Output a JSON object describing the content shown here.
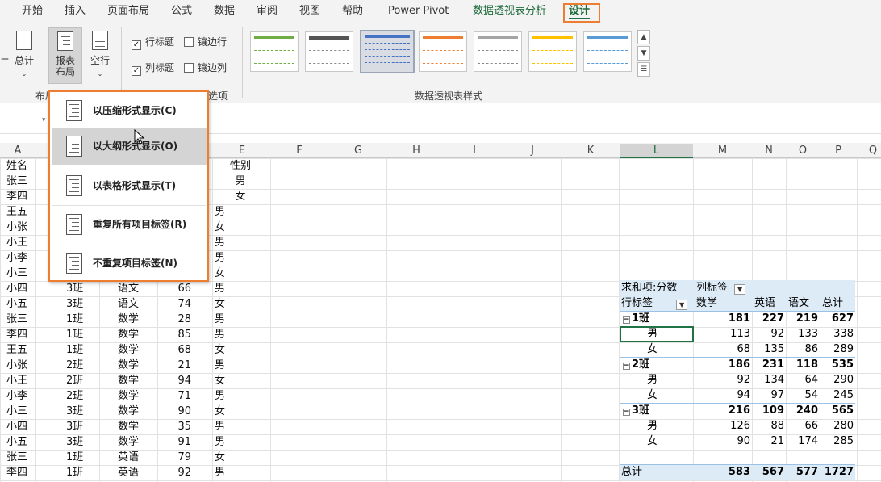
{
  "tabs": [
    "开始",
    "插入",
    "页面布局",
    "公式",
    "数据",
    "审阅",
    "视图",
    "帮助",
    "Power Pivot",
    "数据透视表分析",
    "设计"
  ],
  "ribbon": {
    "layout_buttons": {
      "subtotal": "总计",
      "report_layout": "报表布局",
      "blank_rows": "空行"
    },
    "left_edge_label": "二",
    "options": {
      "row_headers": "行标题",
      "col_headers": "列标题",
      "banded_rows": "镶边行",
      "banded_cols": "镶边列"
    },
    "groups": {
      "layout": "布局",
      "style_options": "选项",
      "styles": "数据透视表样式"
    }
  },
  "menu": {
    "items": [
      "以压缩形式显示(C)",
      "以大纲形式显示(O)",
      "以表格形式显示(T)",
      "重复所有项目标签(R)",
      "不重复项目标签(N)"
    ],
    "hover_index": 1
  },
  "column_headers": [
    "A",
    "B",
    "C",
    "D",
    "E",
    "F",
    "G",
    "H",
    "I",
    "J",
    "K",
    "L",
    "M",
    "N",
    "O",
    "P",
    "Q"
  ],
  "sheet": {
    "header": [
      "姓名",
      "",
      "",
      "",
      "性别"
    ],
    "rows": [
      [
        "张三",
        "",
        "",
        "",
        "男"
      ],
      [
        "李四",
        "",
        "",
        "",
        "女"
      ],
      [
        "王五",
        "",
        "",
        "",
        "男"
      ],
      [
        "小张",
        "",
        "",
        "",
        "女"
      ],
      [
        "小王",
        "",
        "",
        "",
        "男"
      ],
      [
        "小李",
        "",
        "",
        "",
        "男"
      ],
      [
        "小三",
        "",
        "",
        "",
        "女"
      ],
      [
        "小四",
        "3班",
        "语文",
        "66",
        "男"
      ],
      [
        "小五",
        "3班",
        "语文",
        "74",
        "女"
      ],
      [
        "张三",
        "1班",
        "数学",
        "28",
        "男"
      ],
      [
        "李四",
        "1班",
        "数学",
        "85",
        "男"
      ],
      [
        "王五",
        "1班",
        "数学",
        "68",
        "女"
      ],
      [
        "小张",
        "2班",
        "数学",
        "21",
        "男"
      ],
      [
        "小王",
        "2班",
        "数学",
        "94",
        "女"
      ],
      [
        "小李",
        "2班",
        "数学",
        "71",
        "男"
      ],
      [
        "小三",
        "3班",
        "数学",
        "90",
        "女"
      ],
      [
        "小四",
        "3班",
        "数学",
        "35",
        "男"
      ],
      [
        "小五",
        "3班",
        "数学",
        "91",
        "男"
      ],
      [
        "张三",
        "1班",
        "英语",
        "79",
        "女"
      ],
      [
        "李四",
        "1班",
        "英语",
        "92",
        "男"
      ]
    ]
  },
  "pivot": {
    "corner": "求和项:分数",
    "col_label": "列标签",
    "row_label": "行标签",
    "columns": [
      "数学",
      "英语",
      "语文",
      "总计"
    ],
    "rows": [
      {
        "label": "1班",
        "level": 0,
        "values": [
          "181",
          "227",
          "219",
          "627"
        ]
      },
      {
        "label": "男",
        "level": 1,
        "values": [
          "113",
          "92",
          "133",
          "338"
        ]
      },
      {
        "label": "女",
        "level": 1,
        "values": [
          "68",
          "135",
          "86",
          "289"
        ]
      },
      {
        "label": "2班",
        "level": 0,
        "values": [
          "186",
          "231",
          "118",
          "535"
        ]
      },
      {
        "label": "男",
        "level": 1,
        "values": [
          "92",
          "134",
          "64",
          "290"
        ]
      },
      {
        "label": "女",
        "level": 1,
        "values": [
          "94",
          "97",
          "54",
          "245"
        ]
      },
      {
        "label": "3班",
        "level": 0,
        "values": [
          "216",
          "109",
          "240",
          "565"
        ]
      },
      {
        "label": "男",
        "level": 1,
        "values": [
          "126",
          "88",
          "66",
          "280"
        ]
      },
      {
        "label": "女",
        "level": 1,
        "values": [
          "90",
          "21",
          "174",
          "285"
        ]
      }
    ],
    "total": {
      "label": "总计",
      "values": [
        "583",
        "567",
        "577",
        "1727"
      ]
    }
  },
  "colors": {
    "accent": "#ed7d31",
    "excel_green": "#217346",
    "pivot_band": "#ddebf7"
  },
  "icons": [
    "checkbox-icon",
    "dropdown-arrow-icon",
    "report-layout-icon",
    "mouse-cursor-icon",
    "collapse-minus-icon"
  ]
}
